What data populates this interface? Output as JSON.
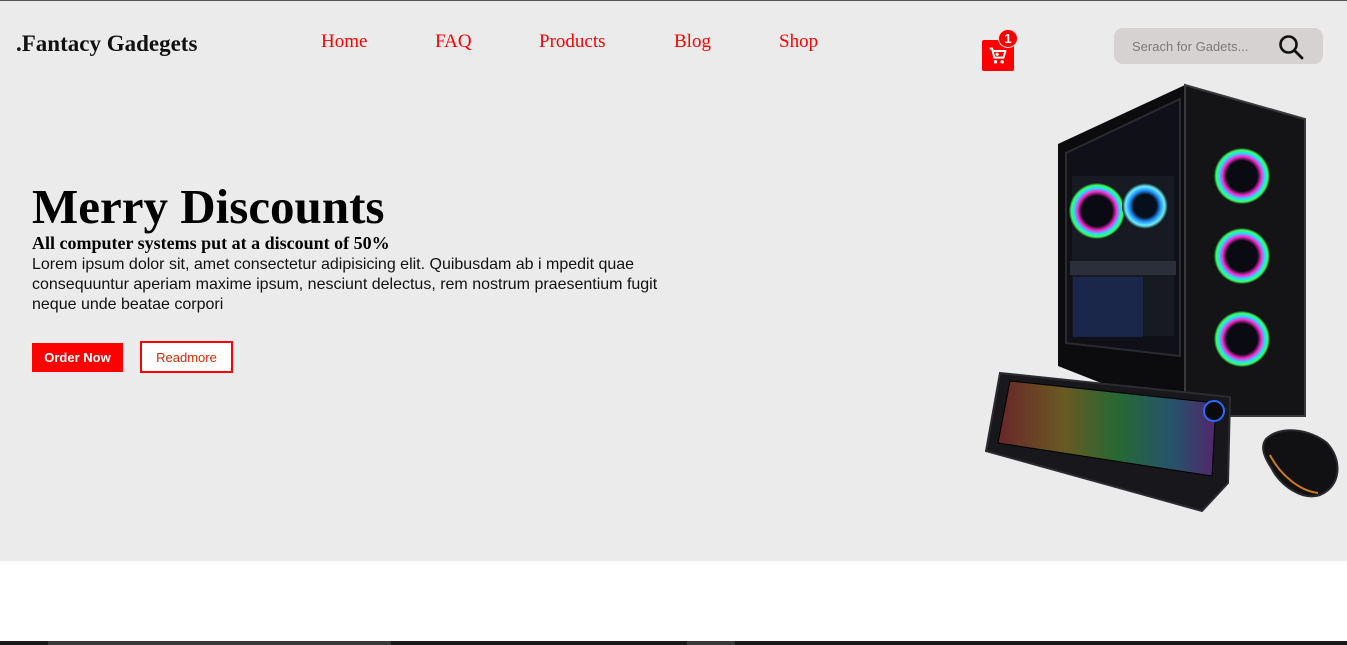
{
  "header": {
    "logo": ".Fantacy Gadegets",
    "nav": [
      "Home",
      "FAQ",
      "Products",
      "Blog",
      "Shop"
    ],
    "cart": {
      "count": "1",
      "icon": "cart-icon"
    },
    "search": {
      "placeholder": "Serach for Gadets...",
      "icon": "search-icon"
    }
  },
  "hero": {
    "title": "Merry Discounts",
    "subtitle": "All computer systems put at a discount of 50%",
    "body": "Lorem ipsum dolor sit, amet consectetur adipisicing elit. Quibusdam ab i mpedit quae consequuntur aperiam maxime ipsum, nesciunt delectus, rem nostrum praesentium fugit neque unde beatae corpori",
    "order_label": "Order Now",
    "readmore_label": "Readmore"
  },
  "colors": {
    "accent": "#ff0000",
    "hero_bg": "#ebebeb",
    "search_bg": "#d6d2d1"
  }
}
